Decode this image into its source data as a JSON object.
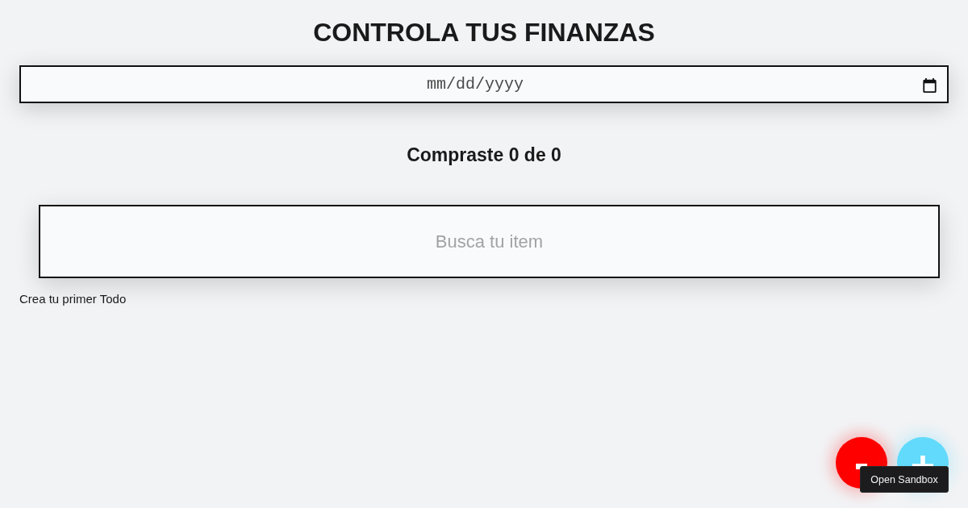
{
  "header": {
    "title": "CONTROLA TUS FINANZAS"
  },
  "date_field": {
    "placeholder": "mm/dd/yyyy"
  },
  "summary": {
    "text": "Compraste 0 de 0"
  },
  "search": {
    "placeholder": "Busca tu item"
  },
  "empty_message": {
    "text": "Crea tu primer Todo"
  },
  "floating_buttons": [
    {
      "kind": "minus",
      "color": "#ff0000"
    },
    {
      "kind": "plus",
      "color": "#61dafb"
    }
  ],
  "tooltip": {
    "text": "Open Sandbox"
  }
}
